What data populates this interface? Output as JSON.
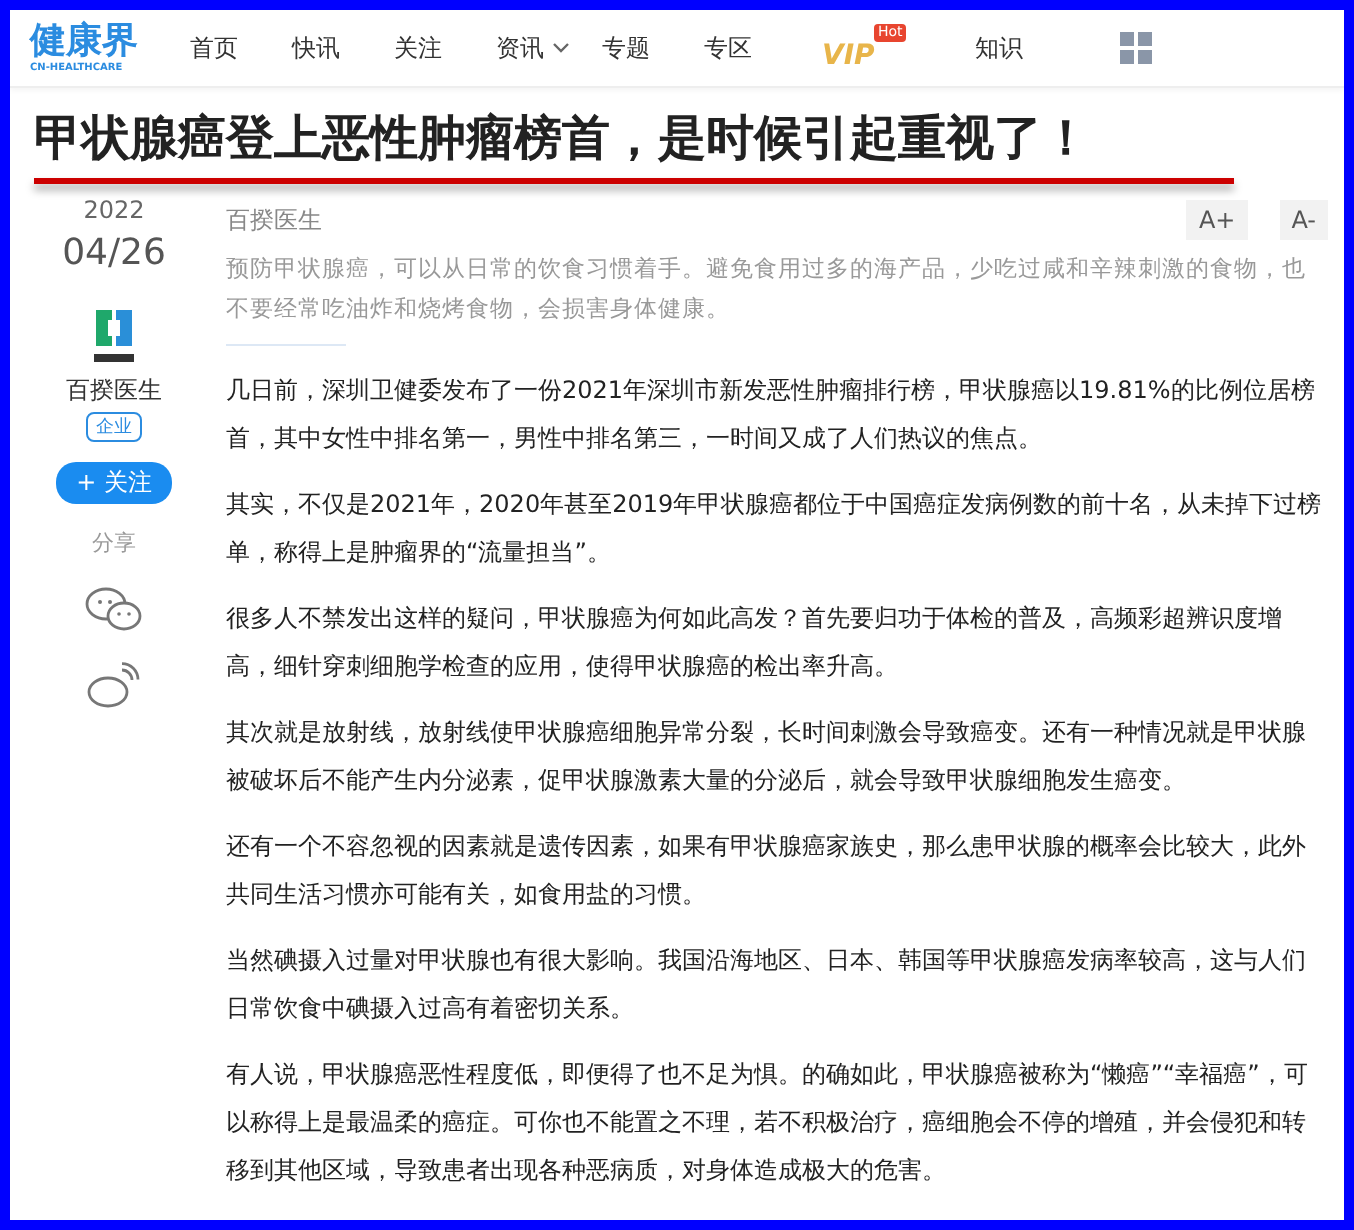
{
  "logo": {
    "name": "健康界",
    "subtitle": "CN-HEALTHCARE"
  },
  "nav": [
    {
      "label": "首页",
      "kind": "link"
    },
    {
      "label": "快讯",
      "kind": "link"
    },
    {
      "label": "关注",
      "kind": "link"
    },
    {
      "label": "资讯",
      "kind": "dropdown"
    },
    {
      "label": "专题",
      "kind": "link"
    },
    {
      "label": "专区",
      "kind": "link"
    },
    {
      "label": "VIP",
      "kind": "vip",
      "badge": "Hot"
    },
    {
      "label": "知识",
      "kind": "link"
    },
    {
      "kind": "grid"
    }
  ],
  "title": "甲状腺癌登上恶性肿瘤榜首，是时候引起重视了！",
  "date": {
    "year": "2022",
    "day": "04/26"
  },
  "author": {
    "name": "百揆医生",
    "tag": "企业",
    "follow": "+ 关注"
  },
  "share": {
    "label": "分享"
  },
  "source": "百揆医生",
  "font_buttons": [
    "A+",
    "A-"
  ],
  "summary": "预防甲状腺癌，可以从日常的饮食习惯着手。避免食用过多的海产品，少吃过咸和辛辣刺激的食物，也不要经常吃油炸和烧烤食物，会损害身体健康。",
  "paragraphs": [
    "几日前，深圳卫健委发布了一份2021年深圳市新发恶性肿瘤排行榜，甲状腺癌以19.81%的比例位居榜首，其中女性中排名第一，男性中排名第三，一时间又成了人们热议的焦点。",
    "其实，不仅是2021年，2020年甚至2019年甲状腺癌都位于中国癌症发病例数的前十名，从未掉下过榜单，称得上是肿瘤界的“流量担当”。",
    "很多人不禁发出这样的疑问，甲状腺癌为何如此高发？首先要归功于体检的普及，高频彩超辨识度增高，细针穿刺细胞学检查的应用，使得甲状腺癌的检出率升高。",
    "其次就是放射线，放射线使甲状腺癌细胞异常分裂，长时间刺激会导致癌变。还有一种情况就是甲状腺被破坏后不能产生内分泌素，促甲状腺激素大量的分泌后，就会导致甲状腺细胞发生癌变。",
    "还有一个不容忽视的因素就是遗传因素，如果有甲状腺癌家族史，那么患甲状腺的概率会比较大，此外共同生活习惯亦可能有关，如食用盐的习惯。",
    "当然碘摄入过量对甲状腺也有很大影响。我国沿海地区、日本、韩国等甲状腺癌发病率较高，这与人们日常饮食中碘摄入过高有着密切关系。",
    "有人说，甲状腺癌恶性程度低，即便得了也不足为惧。的确如此，甲状腺癌被称为“懒癌”“幸福癌”，可以称得上是最温柔的癌症。可你也不能置之不理，若不积极治疗，癌细胞会不停的增殖，并会侵犯和转移到其他区域，导致患者出现各种恶病质，对身体造成极大的危害。"
  ]
}
